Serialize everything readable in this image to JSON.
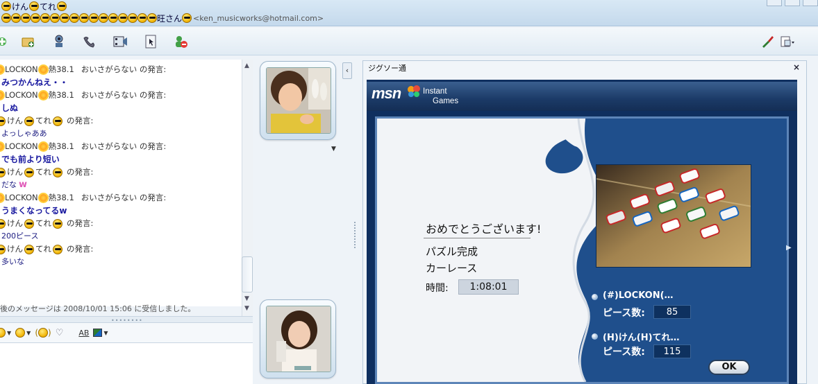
{
  "window": {
    "title_line1": {
      "prefix_emoticon": "cool-emoticon",
      "name_part1": "けん",
      "name_part2": "てれ"
    },
    "title_line2": {
      "repeat_emoticons": 16,
      "name_suffix": "旺さん",
      "email": "<ken_musicworks@hotmail.com>"
    }
  },
  "toolbar": {
    "icons": [
      "invite-contact-icon",
      "send-files-icon",
      "webcam-icon",
      "call-icon",
      "video-icon",
      "activities-icon",
      "block-icon"
    ],
    "right_icons": [
      "paint-brush-icon",
      "display-options-icon"
    ]
  },
  "chat": {
    "messages": [
      {
        "type": "head",
        "speaker": "LOCKON",
        "temp": "熱38.1",
        "extra": "おいさがらない の発言:"
      },
      {
        "type": "body",
        "text": "みつかんねえ・・",
        "bold": true
      },
      {
        "type": "head",
        "speaker": "LOCKON",
        "temp": "熱38.1",
        "extra": "おいさがらない の発言:"
      },
      {
        "type": "body",
        "text": "しぬ",
        "bold": true
      },
      {
        "type": "head2",
        "speaker_a": "けん",
        "speaker_b": "てれ",
        "extra": "の発言:"
      },
      {
        "type": "body",
        "text": "よっしゃああ",
        "bold": false
      },
      {
        "type": "head",
        "speaker": "LOCKON",
        "temp": "熱38.1",
        "extra": "おいさがらない の発言:"
      },
      {
        "type": "body",
        "text": "でも前より短い",
        "bold": true
      },
      {
        "type": "head2",
        "speaker_a": "けん",
        "speaker_b": "てれ",
        "extra": "の発言:"
      },
      {
        "type": "body",
        "text": "だな",
        "bold": false,
        "heart": "w"
      },
      {
        "type": "head",
        "speaker": "LOCKON",
        "temp": "熱38.1",
        "extra": "おいさがらない の発言:"
      },
      {
        "type": "body",
        "text": "うまくなってるw",
        "bold": true
      },
      {
        "type": "head2",
        "speaker_a": "けん",
        "speaker_b": "てれ",
        "extra": "の発言:"
      },
      {
        "type": "body",
        "text": "200ピース",
        "bold": false
      },
      {
        "type": "head2",
        "speaker_a": "けん",
        "speaker_b": "てれ",
        "extra": "の発言:"
      },
      {
        "type": "body",
        "text": "多いな",
        "bold": false
      }
    ],
    "last_message": "後のメッセージは 2008/10/01 15:06 に受信しました。"
  },
  "input_tools": {
    "items": [
      {
        "name": "emoticon-tool",
        "icon": "smile-icon"
      },
      {
        "name": "wink-tool",
        "icon": "wink-icon"
      },
      {
        "name": "nudge-tool",
        "icon": "nudge-icon"
      },
      {
        "name": "voice-clip-tool",
        "icon": "heart-icon"
      },
      {
        "name": "font-tool",
        "label": "AB"
      },
      {
        "name": "background-tool",
        "icon": "background-icon"
      }
    ]
  },
  "game": {
    "panel_title": "ジグソー通",
    "brand": "msn",
    "brand_sub1": "Instant",
    "brand_sub2": "Games",
    "congrats": "おめでとうございます!",
    "puzzle_done": "パズル完成",
    "puzzle_name": "カーレース",
    "time_label": "時間:",
    "time_value": "1:08:01",
    "players": [
      {
        "name": "(#)LOCKON(…",
        "pieces_label": "ピース数:",
        "pieces": "85"
      },
      {
        "name": "(H)けん(H)てれ…",
        "pieces_label": "ピース数:",
        "pieces": "115"
      }
    ],
    "ok_label": "OK"
  },
  "colors": {
    "board_blue": "#1f4f8c",
    "chat_bold_text": "#1a1aa0",
    "accent_pink": "#e05ab8"
  }
}
